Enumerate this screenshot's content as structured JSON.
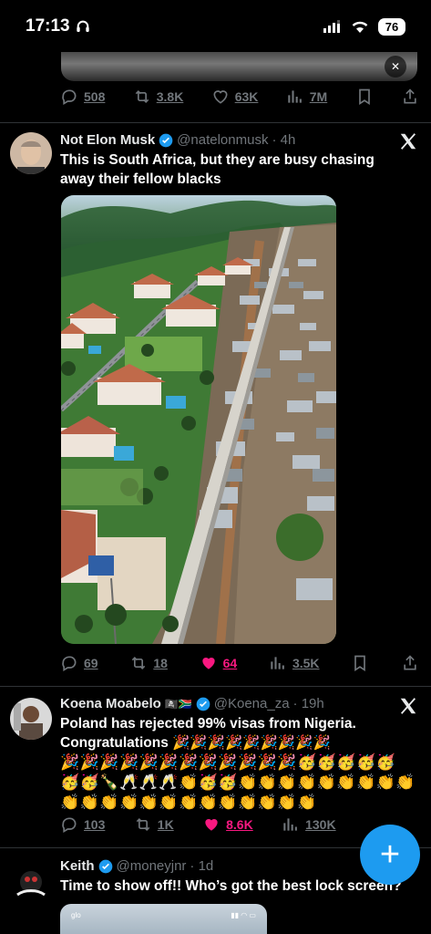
{
  "status_bar": {
    "time": "17:13",
    "battery": "76"
  },
  "tweets": [
    {
      "stats": {
        "replies": "508",
        "retweets": "3.8K",
        "likes": "63K",
        "views": "7M"
      }
    },
    {
      "name": "Not Elon Musk",
      "handle": "@natelonmusk",
      "time": "· 4h",
      "text_line1": "This is South Africa, but they are busy chasing",
      "text_line2": "away their fellow blacks",
      "stats": {
        "replies": "69",
        "retweets": "18",
        "likes": "64",
        "views": "3.5K"
      }
    },
    {
      "name": "Koena Moabelo",
      "flags": "🏴‍☠️🇿🇦",
      "handle": "@Koena_za",
      "time": "· 19h",
      "text_line1": "Poland has rejected 99% visas from Nigeria.",
      "text_line2": "Congratulations 🎉🎉🎉🎉🎉🎉🎉🎉🎉",
      "emoji_line1": "🎉🎉🎉🎉🎉🎉🎉🎉🎉🎉🎉🎉🥳🥳🥳🥳🥳",
      "emoji_line2": "🥳🥳🍾🥂🥂🥂👏🥳🥳👏👏👏👏👏👏👏👏👏",
      "emoji_line3": "👏👏👏👏👏👏👏👏👏👏👏👏👏",
      "stats": {
        "replies": "103",
        "retweets": "1K",
        "likes": "8.6K",
        "views": "130K"
      }
    },
    {
      "name": "Keith",
      "handle": "@moneyjnr",
      "time": "· 1d",
      "text_line1": "Time to show off!! Who’s got the best lock screen?",
      "preview_carrier": "glo"
    }
  ],
  "fab": {
    "label": "+"
  },
  "colors": {
    "accent": "#1d9bf0",
    "like": "#f91880",
    "muted": "#71767b"
  }
}
